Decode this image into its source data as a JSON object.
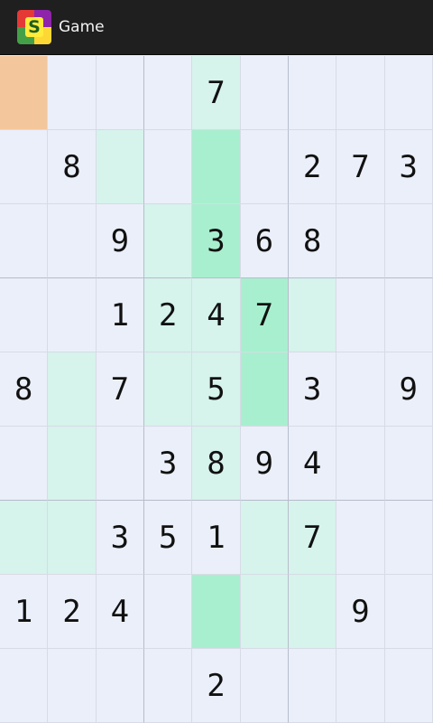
{
  "header": {
    "title": "Game",
    "icon_letter": "S"
  },
  "board": {
    "rows": [
      [
        "",
        "",
        "",
        "",
        "7",
        "",
        "",
        "",
        ""
      ],
      [
        "",
        "8",
        "",
        "",
        "",
        "",
        "2",
        "7",
        "3"
      ],
      [
        "",
        "",
        "9",
        "",
        "3",
        "6",
        "8",
        "",
        ""
      ],
      [
        "",
        "",
        "1",
        "2",
        "4",
        "7",
        "",
        "",
        ""
      ],
      [
        "8",
        "",
        "7",
        "",
        "5",
        "",
        "3",
        "",
        "9"
      ],
      [
        "",
        "",
        "",
        "3",
        "8",
        "9",
        "4",
        "",
        ""
      ],
      [
        "",
        "",
        "3",
        "5",
        "1",
        "",
        "7",
        "",
        ""
      ],
      [
        "1",
        "2",
        "4",
        "",
        "",
        "",
        "",
        "9",
        ""
      ],
      [
        "",
        "",
        "",
        "",
        "2",
        "",
        "",
        "",
        ""
      ]
    ],
    "highlight": [
      [
        "s",
        "",
        "",
        "",
        "l",
        "",
        "",
        "",
        ""
      ],
      [
        "",
        "",
        "l",
        "",
        "d",
        "",
        "",
        "",
        ""
      ],
      [
        "",
        "",
        "",
        "l",
        "d",
        "",
        "",
        "",
        ""
      ],
      [
        "",
        "",
        "",
        "l",
        "l",
        "d",
        "l",
        "",
        ""
      ],
      [
        "",
        "l",
        "",
        "l",
        "l",
        "d",
        "",
        "",
        ""
      ],
      [
        "",
        "l",
        "",
        "",
        "l",
        "",
        "",
        "",
        ""
      ],
      [
        "l",
        "l",
        "",
        "",
        "",
        "l",
        "l",
        "",
        ""
      ],
      [
        "",
        "",
        "",
        "",
        "d",
        "l",
        "l",
        "",
        ""
      ],
      [
        "",
        "",
        "",
        "",
        "",
        "",
        "",
        "",
        ""
      ]
    ],
    "colors": {
      "selected": "#f4c69c",
      "light": "#d6f3ec",
      "dark": "#a8efcf",
      "empty": "#ebeff9"
    }
  }
}
